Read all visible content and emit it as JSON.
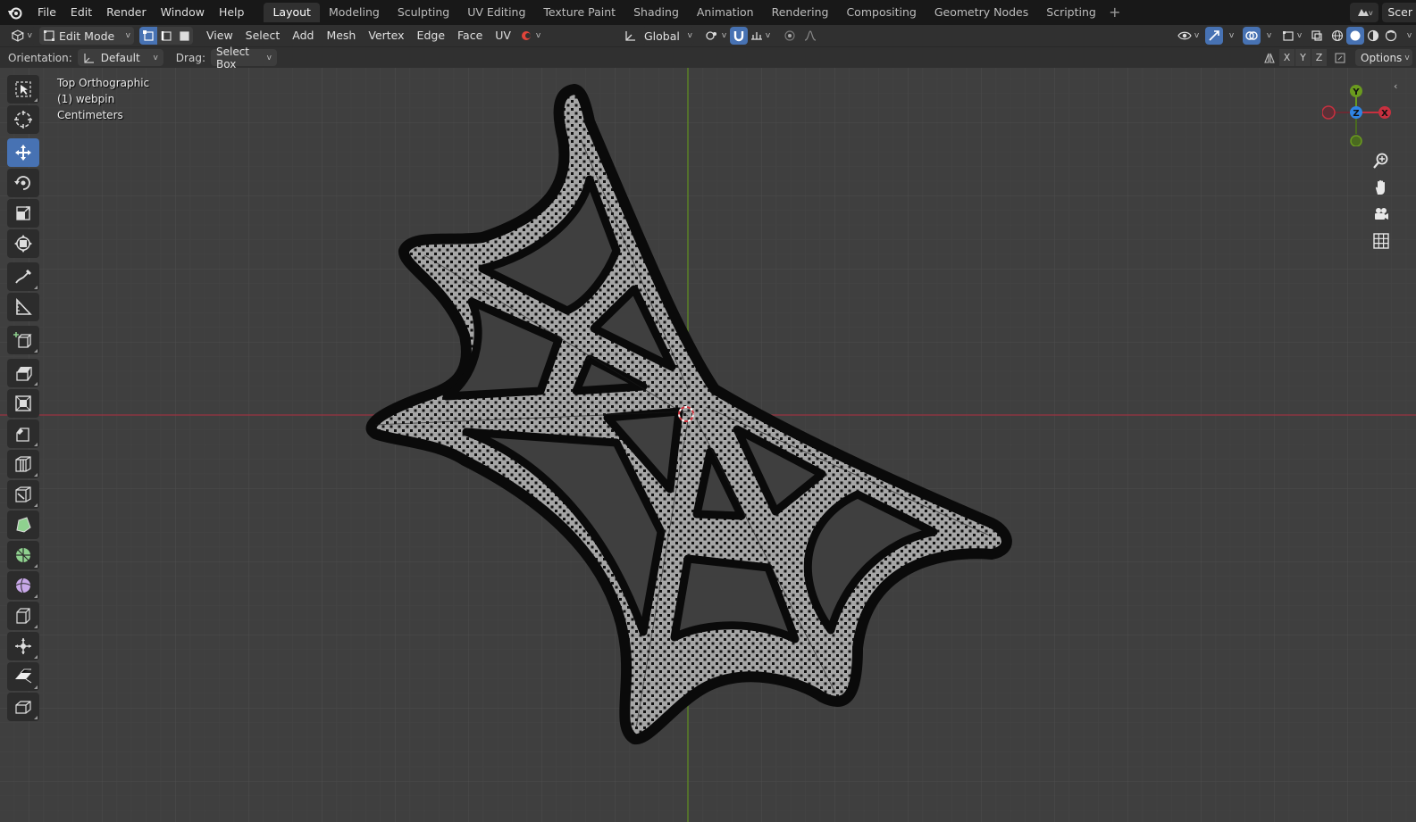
{
  "menu": {
    "items": [
      "File",
      "Edit",
      "Render",
      "Window",
      "Help"
    ]
  },
  "workspaces": {
    "tabs": [
      "Layout",
      "Modeling",
      "Sculpting",
      "UV Editing",
      "Texture Paint",
      "Shading",
      "Animation",
      "Rendering",
      "Compositing",
      "Geometry Nodes",
      "Scripting"
    ],
    "active": "Layout",
    "add_label": "+"
  },
  "scene": {
    "label": "Scer"
  },
  "header": {
    "mode": "Edit Mode",
    "menus": [
      "View",
      "Select",
      "Add",
      "Mesh",
      "Vertex",
      "Edge",
      "Face",
      "UV"
    ],
    "transform_orientation": "Global"
  },
  "tool_settings": {
    "orientation_label": "Orientation:",
    "orientation_value": "Default",
    "drag_label": "Drag:",
    "drag_value": "Select Box",
    "axes": [
      "X",
      "Y",
      "Z"
    ],
    "options_label": "Options"
  },
  "viewport": {
    "view_name": "Top Orthographic",
    "object_name": "(1) webpin",
    "units": "Centimeters"
  },
  "gizmo": {
    "y_label": "Y",
    "x_label": "X",
    "z_label": "Z"
  },
  "colors": {
    "accent": "#4772b3",
    "x_axis": "#c8303f",
    "y_axis": "#6a9a1e",
    "z_axis": "#2f84e3",
    "viewport_bg": "#3f3f3f"
  },
  "icons": {
    "toolbar": [
      "select-box-icon",
      "cursor-icon",
      "move-icon",
      "rotate-icon",
      "scale-icon",
      "transform-icon",
      "annotate-icon",
      "measure-icon",
      "add-cube-icon",
      "extrude-region-icon",
      "inset-faces-icon",
      "bevel-icon",
      "loop-cut-icon",
      "knife-icon",
      "poly-build-icon",
      "spin-icon",
      "smooth-icon",
      "edge-slide-icon",
      "shrink-fatten-icon",
      "shear-icon",
      "rip-region-icon"
    ]
  }
}
